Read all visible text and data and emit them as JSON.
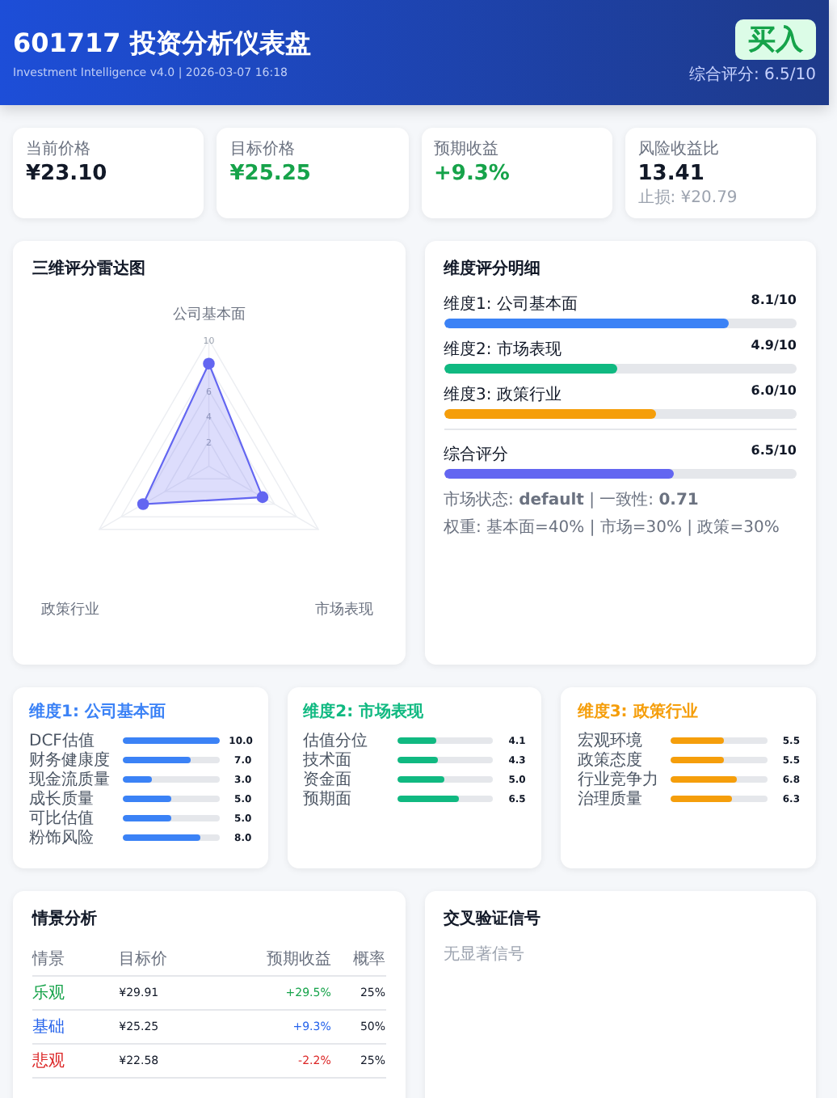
{
  "header": {
    "title": "601717 投资分析仪表盘",
    "subtitle": "Investment Intelligence v4.0 | 2026-03-07 16:18",
    "rating": "买入",
    "score": "综合评分: 6.5/10"
  },
  "stats": [
    {
      "label": "当前价格",
      "value": "¥23.10",
      "color": "#111827"
    },
    {
      "label": "目标价格",
      "value": "¥25.25",
      "color": "#16a34a"
    },
    {
      "label": "预期收益",
      "value": "+9.3%",
      "color": "#16a34a"
    },
    {
      "label": "风险收益比",
      "value": "13.41",
      "color": "#111827",
      "note": "止损: ¥20.79"
    }
  ],
  "radar": {
    "title": "三维评分雷达图",
    "axes": [
      "公司基本面",
      "市场表现",
      "政策行业"
    ],
    "ticks": [
      "10",
      "6",
      "4",
      "2"
    ]
  },
  "breakdown": {
    "title": "维度评分明细",
    "dims": [
      {
        "label": "维度1: 公司基本面",
        "score": "8.1/10",
        "level": 0.81,
        "color": "#3b82f6"
      },
      {
        "label": "维度2: 市场表现",
        "score": "4.9/10",
        "level": 0.49,
        "color": "#10b981"
      },
      {
        "label": "维度3: 政策行业",
        "score": "6.0/10",
        "level": 0.6,
        "color": "#f59e0b"
      }
    ],
    "total": {
      "label": "综合评分",
      "score": "6.5/10",
      "level": 0.65,
      "color": "#6366f1"
    },
    "notes": [
      "市场状态: **default** | 一致性: **0.71**",
      "权重: 基本面=40% | 市场=30% | 政策=30%"
    ]
  },
  "dim_cards": [
    {
      "title": "维度1: 公司基本面",
      "color": "#3b82f6",
      "rows": [
        {
          "label": "DCF估值",
          "level": 1.0,
          "value": "10.0"
        },
        {
          "label": "财务健康度",
          "level": 0.7,
          "value": "7.0"
        },
        {
          "label": "现金流质量",
          "level": 0.3,
          "value": "3.0"
        },
        {
          "label": "成长质量",
          "level": 0.5,
          "value": "5.0"
        },
        {
          "label": "可比估值",
          "level": 0.5,
          "value": "5.0"
        },
        {
          "label": "粉饰风险",
          "level": 0.8,
          "value": "8.0"
        }
      ]
    },
    {
      "title": "维度2: 市场表现",
      "color": "#10b981",
      "rows": [
        {
          "label": "估值分位",
          "level": 0.41,
          "value": "4.1"
        },
        {
          "label": "技术面",
          "level": 0.43,
          "value": "4.3"
        },
        {
          "label": "资金面",
          "level": 0.5,
          "value": "5.0"
        },
        {
          "label": "预期面",
          "level": 0.65,
          "value": "6.5"
        }
      ]
    },
    {
      "title": "维度3: 政策行业",
      "color": "#f59e0b",
      "rows": [
        {
          "label": "宏观环境",
          "level": 0.55,
          "value": "5.5"
        },
        {
          "label": "政策态度",
          "level": 0.55,
          "value": "5.5"
        },
        {
          "label": "行业竞争力",
          "level": 0.68,
          "value": "6.8"
        },
        {
          "label": "治理质量",
          "level": 0.63,
          "value": "6.3"
        }
      ]
    }
  ],
  "scenarios": {
    "title": "情景分析",
    "columns": [
      "情景",
      "目标价",
      "预期收益",
      "概率"
    ],
    "rows": [
      {
        "name": "乐观",
        "target": "¥29.91",
        "ret": "+29.5%",
        "prob": "25%",
        "color": "#16a34a"
      },
      {
        "name": "基础",
        "target": "¥25.25",
        "ret": "+9.3%",
        "prob": "50%",
        "color": "#2563eb"
      },
      {
        "name": "悲观",
        "target": "¥22.58",
        "ret": "-2.2%",
        "prob": "25%",
        "color": "#dc2626"
      }
    ]
  },
  "signals": {
    "title": "交叉验证信号",
    "empty": "无显著信号"
  }
}
